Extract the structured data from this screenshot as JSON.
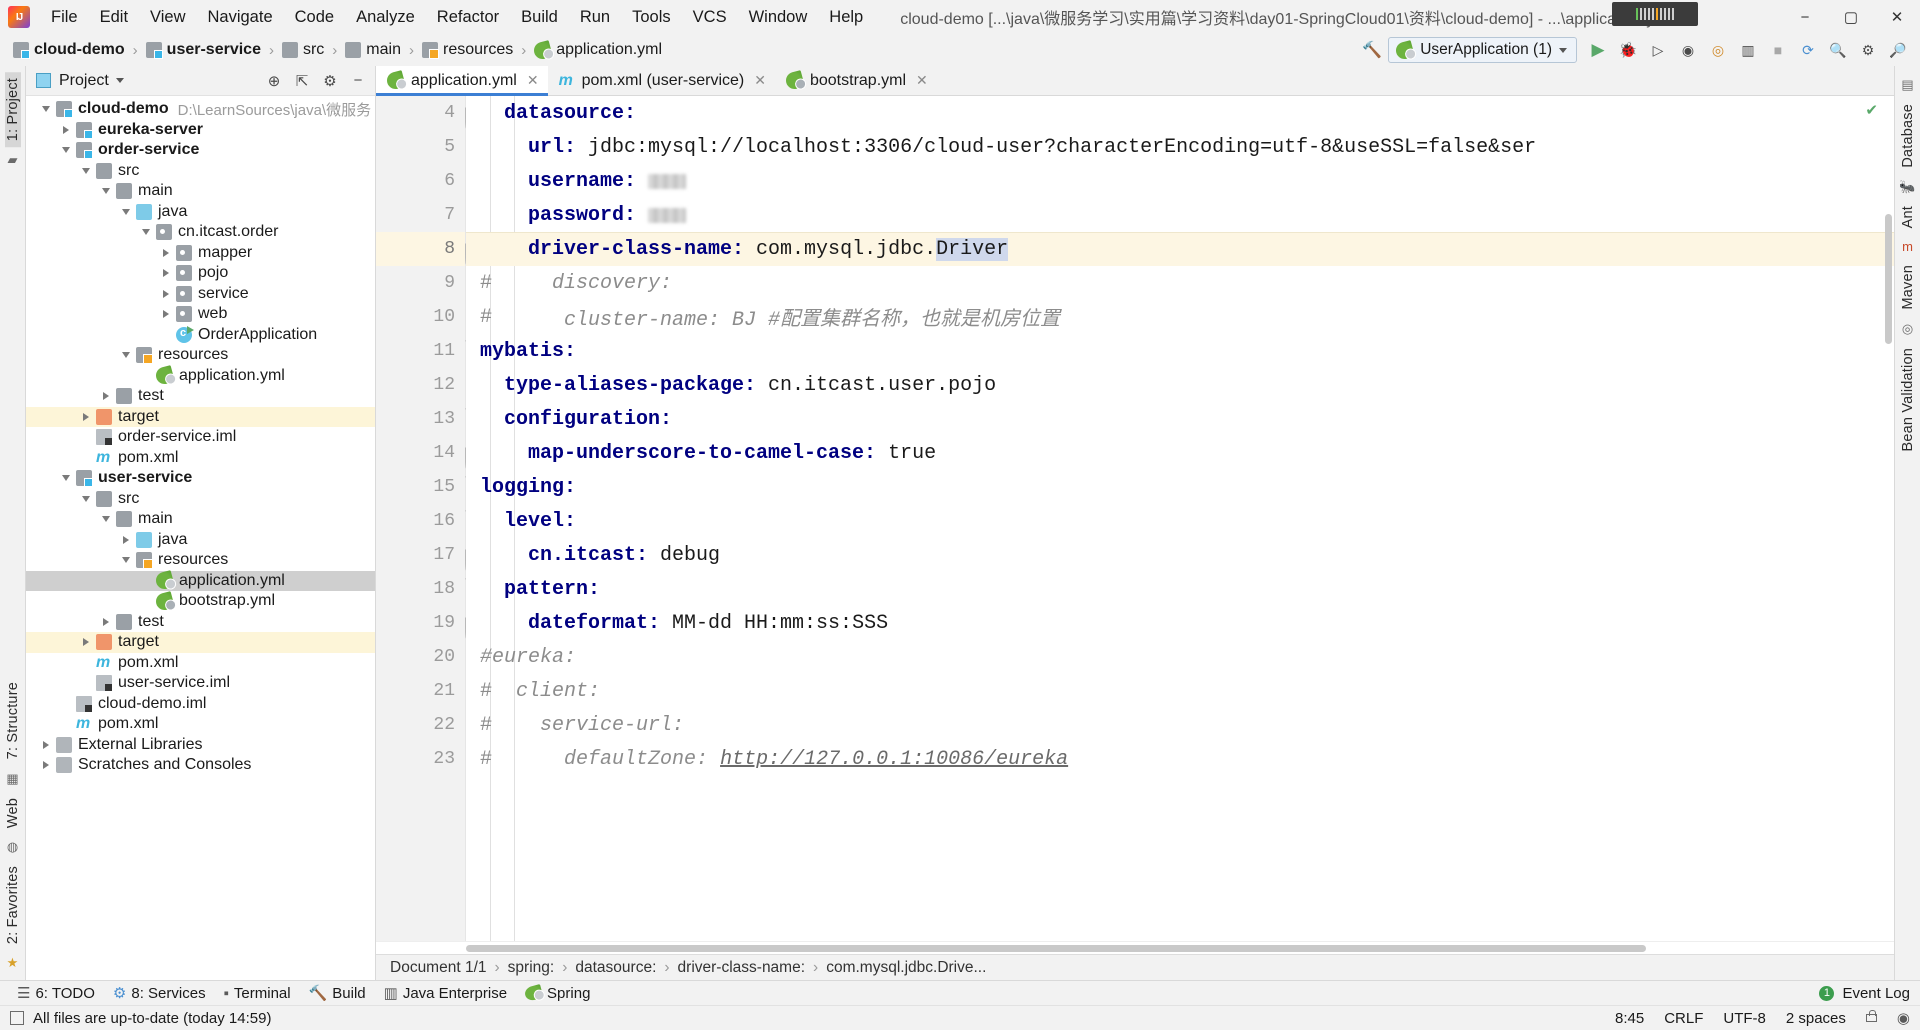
{
  "window": {
    "title": "cloud-demo [...\\java\\微服务学习\\实用篇\\学习资料\\day01-SpringCloud01\\资料\\cloud-demo] - ...\\application.yml [user-service]",
    "minimize": "−",
    "maximize": "▢",
    "close": "✕"
  },
  "menubar": [
    {
      "label": "File"
    },
    {
      "label": "Edit"
    },
    {
      "label": "View"
    },
    {
      "label": "Navigate"
    },
    {
      "label": "Code"
    },
    {
      "label": "Analyze"
    },
    {
      "label": "Refactor"
    },
    {
      "label": "Build"
    },
    {
      "label": "Run"
    },
    {
      "label": "Tools"
    },
    {
      "label": "VCS"
    },
    {
      "label": "Window"
    },
    {
      "label": "Help"
    }
  ],
  "navbar": {
    "crumbs": [
      {
        "label": "cloud-demo",
        "icon": "module-icon",
        "bold": true
      },
      {
        "label": "user-service",
        "icon": "module-icon",
        "bold": true
      },
      {
        "label": "src",
        "icon": "folder-icon",
        "bold": false
      },
      {
        "label": "main",
        "icon": "folder-icon",
        "bold": false
      },
      {
        "label": "resources",
        "icon": "resources-folder-icon",
        "bold": false
      },
      {
        "label": "application.yml",
        "icon": "spring-yaml-icon",
        "bold": false
      }
    ],
    "run_config": "UserApplication (1)",
    "separator": "›"
  },
  "project_panel": {
    "title": "Project",
    "tree": [
      {
        "indent": 0,
        "arrow": "open",
        "icon": "module-icon",
        "label": "cloud-demo",
        "bold": true,
        "path": "D:\\LearnSources\\java\\微服务学习\\实用篇"
      },
      {
        "indent": 1,
        "arrow": "closed",
        "icon": "module-icon",
        "label": "eureka-server",
        "bold": true
      },
      {
        "indent": 1,
        "arrow": "open",
        "icon": "module-icon",
        "label": "order-service",
        "bold": true
      },
      {
        "indent": 2,
        "arrow": "open",
        "icon": "folder-icon",
        "label": "src"
      },
      {
        "indent": 3,
        "arrow": "open",
        "icon": "folder-icon",
        "label": "main"
      },
      {
        "indent": 4,
        "arrow": "open",
        "icon": "source-folder-icon",
        "label": "java"
      },
      {
        "indent": 5,
        "arrow": "open",
        "icon": "package-icon",
        "label": "cn.itcast.order"
      },
      {
        "indent": 6,
        "arrow": "closed",
        "icon": "package-icon",
        "label": "mapper"
      },
      {
        "indent": 6,
        "arrow": "closed",
        "icon": "package-icon",
        "label": "pojo"
      },
      {
        "indent": 6,
        "arrow": "closed",
        "icon": "package-icon",
        "label": "service"
      },
      {
        "indent": 6,
        "arrow": "closed",
        "icon": "package-icon",
        "label": "web"
      },
      {
        "indent": 6,
        "arrow": "none",
        "icon": "java-class-run-icon",
        "label": "OrderApplication"
      },
      {
        "indent": 4,
        "arrow": "open",
        "icon": "resources-folder-icon",
        "label": "resources"
      },
      {
        "indent": 5,
        "arrow": "none",
        "icon": "spring-yaml-icon",
        "label": "application.yml"
      },
      {
        "indent": 3,
        "arrow": "closed",
        "icon": "folder-icon",
        "label": "test"
      },
      {
        "indent": 2,
        "arrow": "closed",
        "icon": "target-folder-icon",
        "label": "target",
        "highlight": true
      },
      {
        "indent": 2,
        "arrow": "none",
        "icon": "iml-file-icon",
        "label": "order-service.iml"
      },
      {
        "indent": 2,
        "arrow": "none",
        "icon": "maven-icon",
        "label": "pom.xml"
      },
      {
        "indent": 1,
        "arrow": "open",
        "icon": "module-icon",
        "label": "user-service",
        "bold": true
      },
      {
        "indent": 2,
        "arrow": "open",
        "icon": "folder-icon",
        "label": "src"
      },
      {
        "indent": 3,
        "arrow": "open",
        "icon": "folder-icon",
        "label": "main"
      },
      {
        "indent": 4,
        "arrow": "closed",
        "icon": "source-folder-icon",
        "label": "java"
      },
      {
        "indent": 4,
        "arrow": "open",
        "icon": "resources-folder-icon",
        "label": "resources"
      },
      {
        "indent": 5,
        "arrow": "none",
        "icon": "spring-yaml-icon",
        "label": "application.yml",
        "selected": true
      },
      {
        "indent": 5,
        "arrow": "none",
        "icon": "spring-bootstrap-icon",
        "label": "bootstrap.yml"
      },
      {
        "indent": 3,
        "arrow": "closed",
        "icon": "folder-icon",
        "label": "test"
      },
      {
        "indent": 2,
        "arrow": "closed",
        "icon": "target-folder-icon",
        "label": "target",
        "highlight": true
      },
      {
        "indent": 2,
        "arrow": "none",
        "icon": "maven-icon",
        "label": "pom.xml"
      },
      {
        "indent": 2,
        "arrow": "none",
        "icon": "iml-file-icon",
        "label": "user-service.iml"
      },
      {
        "indent": 1,
        "arrow": "none",
        "icon": "iml-file-icon",
        "label": "cloud-demo.iml"
      },
      {
        "indent": 1,
        "arrow": "none",
        "icon": "maven-icon",
        "label": "pom.xml"
      },
      {
        "indent": 0,
        "arrow": "closed",
        "icon": "library-icon",
        "label": "External Libraries"
      },
      {
        "indent": 0,
        "arrow": "closed",
        "icon": "scratch-icon",
        "label": "Scratches and Consoles"
      }
    ]
  },
  "left_rail": {
    "top": "1: Project",
    "bottom": [
      "7: Structure",
      "Web",
      "2: Favorites"
    ]
  },
  "right_rail": {
    "items": [
      "Database",
      "Ant",
      "Maven",
      "Bean Validation"
    ]
  },
  "tabs": [
    {
      "label": "application.yml",
      "icon": "spring-yaml-icon",
      "active": true,
      "close": "✕"
    },
    {
      "label": "pom.xml (user-service)",
      "icon": "maven-icon",
      "active": false,
      "close": "✕"
    },
    {
      "label": "bootstrap.yml",
      "icon": "spring-bootstrap-icon",
      "active": false,
      "close": "✕"
    }
  ],
  "editor": {
    "first_line_number": 4,
    "lines": [
      {
        "n": 4,
        "indent": 1,
        "fold": "pin",
        "tokens": [
          {
            "t": "datasource:",
            "c": "k"
          }
        ]
      },
      {
        "n": 5,
        "indent": 2,
        "tokens": [
          {
            "t": "url:",
            "c": "k"
          },
          {
            "t": " jdbc:mysql://localhost:3306/cloud-user?characterEncoding=utf-8&useSSL=false&ser",
            "c": "val"
          }
        ]
      },
      {
        "n": 6,
        "indent": 2,
        "tokens": [
          {
            "t": "username:",
            "c": "k"
          },
          {
            "t": " ",
            "c": "val"
          },
          {
            "t": "",
            "c": "blur",
            "w": 38
          }
        ]
      },
      {
        "n": 7,
        "indent": 2,
        "tokens": [
          {
            "t": "password:",
            "c": "k"
          },
          {
            "t": " ",
            "c": "val"
          },
          {
            "t": "",
            "c": "blur",
            "w": 38
          }
        ]
      },
      {
        "n": 8,
        "indent": 2,
        "fold": "pin",
        "current": true,
        "tokens": [
          {
            "t": "driver-class-name:",
            "c": "k"
          },
          {
            "t": " com.mysql.jdbc.",
            "c": "val"
          },
          {
            "t": "Driver",
            "c": "sel"
          }
        ]
      },
      {
        "n": 9,
        "indent": 0,
        "tokens": [
          {
            "t": "#",
            "c": "cmt-h"
          },
          {
            "t": "     discovery:",
            "c": "cmt"
          }
        ]
      },
      {
        "n": 10,
        "indent": 0,
        "tokens": [
          {
            "t": "#",
            "c": "cmt-h"
          },
          {
            "t": "      cluster-name: BJ #配置集群名称，也就是机房位置",
            "c": "cmt"
          }
        ]
      },
      {
        "n": 11,
        "indent": 0,
        "fold": "chev",
        "tokens": [
          {
            "t": "mybatis:",
            "c": "k"
          }
        ]
      },
      {
        "n": 12,
        "indent": 1,
        "tokens": [
          {
            "t": "type-aliases-package:",
            "c": "k"
          },
          {
            "t": " cn.itcast.user.pojo",
            "c": "val"
          }
        ]
      },
      {
        "n": 13,
        "indent": 1,
        "fold": "chev",
        "tokens": [
          {
            "t": "configuration:",
            "c": "k"
          }
        ]
      },
      {
        "n": 14,
        "indent": 2,
        "fold": "pin",
        "tokens": [
          {
            "t": "map-underscore-to-camel-case:",
            "c": "k"
          },
          {
            "t": " true",
            "c": "val"
          }
        ]
      },
      {
        "n": 15,
        "indent": 0,
        "fold": "chev",
        "tokens": [
          {
            "t": "logging:",
            "c": "k"
          }
        ]
      },
      {
        "n": 16,
        "indent": 1,
        "fold": "chev",
        "tokens": [
          {
            "t": "level:",
            "c": "k"
          }
        ]
      },
      {
        "n": 17,
        "indent": 2,
        "fold": "pin",
        "tokens": [
          {
            "t": "cn.itcast:",
            "c": "k"
          },
          {
            "t": " debug",
            "c": "val"
          }
        ]
      },
      {
        "n": 18,
        "indent": 1,
        "fold": "chev",
        "tokens": [
          {
            "t": "pattern:",
            "c": "k"
          }
        ]
      },
      {
        "n": 19,
        "indent": 2,
        "fold": "pin",
        "tokens": [
          {
            "t": "dateformat:",
            "c": "k"
          },
          {
            "t": " MM-dd HH:mm:ss:SSS",
            "c": "val"
          }
        ]
      },
      {
        "n": 20,
        "indent": 0,
        "tokens": [
          {
            "t": "#eureka:",
            "c": "cmt"
          }
        ]
      },
      {
        "n": 21,
        "indent": 0,
        "tokens": [
          {
            "t": "#",
            "c": "cmt-h"
          },
          {
            "t": "  client:",
            "c": "cmt"
          }
        ]
      },
      {
        "n": 22,
        "indent": 0,
        "tokens": [
          {
            "t": "#",
            "c": "cmt-h"
          },
          {
            "t": "    service-url:",
            "c": "cmt"
          }
        ]
      },
      {
        "n": 23,
        "indent": 0,
        "tokens": [
          {
            "t": "#",
            "c": "cmt-h"
          },
          {
            "t": "      defaultZone: ",
            "c": "cmt"
          },
          {
            "t": "http://127.0.0.1:10086/eureka",
            "c": "link"
          }
        ]
      }
    ]
  },
  "breadcrumb_bar": {
    "items": [
      "Document 1/1",
      "spring:",
      "datasource:",
      "driver-class-name:",
      "com.mysql.jdbc.Drive..."
    ],
    "separator": "›"
  },
  "tool_windows": [
    {
      "label": "6: TODO",
      "icon": "todo-icon"
    },
    {
      "label": "8: Services",
      "icon": "services-icon"
    },
    {
      "label": "Terminal",
      "icon": "terminal-icon"
    },
    {
      "label": "Build",
      "icon": "build-icon"
    },
    {
      "label": "Java Enterprise",
      "icon": "java-enterprise-icon"
    },
    {
      "label": "Spring",
      "icon": "spring-icon"
    }
  ],
  "event_log": {
    "label": "Event Log",
    "count": "1"
  },
  "statusbar": {
    "message": "All files are up-to-date (today 14:59)",
    "caret": "8:45",
    "line_separator": "CRLF",
    "encoding": "UTF-8",
    "indent": "2 spaces"
  }
}
